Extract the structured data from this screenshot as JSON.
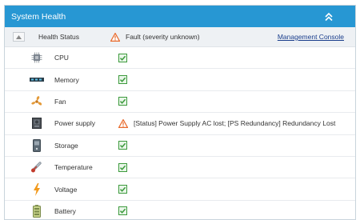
{
  "panel": {
    "title": "System Health",
    "collapse_icon": "double-chevron-up-icon"
  },
  "header": {
    "column_label": "Health Status",
    "status_icon": "warning-triangle-icon",
    "status_text": "Fault (severity unknown)",
    "console_link": "Management Console"
  },
  "colors": {
    "titlebar": "#2797d3",
    "ok_green": "#3c9a3c",
    "warning_orange": "#e8692a",
    "link": "#1a3e8c"
  },
  "components": [
    {
      "key": "cpu",
      "label": "CPU",
      "icon": "cpu-icon",
      "status": "ok",
      "text": ""
    },
    {
      "key": "memory",
      "label": "Memory",
      "icon": "memory-icon",
      "status": "ok",
      "text": ""
    },
    {
      "key": "fan",
      "label": "Fan",
      "icon": "fan-icon",
      "status": "ok",
      "text": ""
    },
    {
      "key": "power-supply",
      "label": "Power supply",
      "icon": "power-supply-icon",
      "status": "warning",
      "text": "[Status] Power Supply AC lost; [PS Redundancy] Redundancy Lost"
    },
    {
      "key": "storage",
      "label": "Storage",
      "icon": "storage-icon",
      "status": "ok",
      "text": ""
    },
    {
      "key": "temperature",
      "label": "Temperature",
      "icon": "thermometer-icon",
      "status": "ok",
      "text": ""
    },
    {
      "key": "voltage",
      "label": "Voltage",
      "icon": "lightning-icon",
      "status": "ok",
      "text": ""
    },
    {
      "key": "battery",
      "label": "Battery",
      "icon": "battery-icon",
      "status": "ok",
      "text": ""
    }
  ]
}
